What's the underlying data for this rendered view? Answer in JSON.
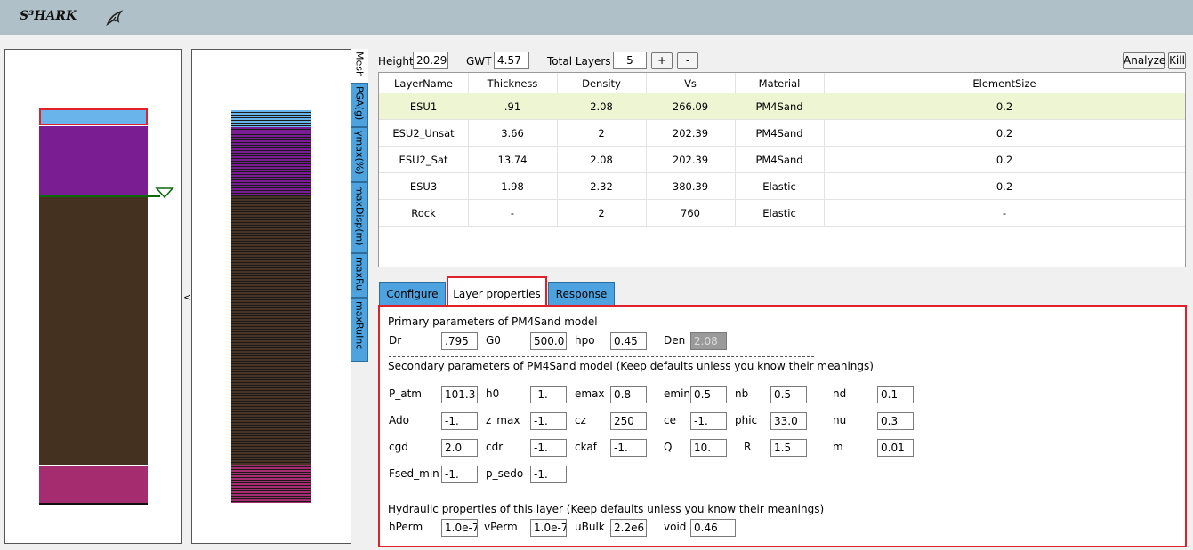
{
  "header": {
    "app_name": "S³HARK",
    "logo_icon": "shark-icon"
  },
  "colors": {
    "top_layer": "#6ab4ec",
    "unsat_layer": "#7a1c92",
    "sat_layer": "#443120",
    "bottom_layer": "#a52d6f",
    "accent_red": "#e0202a",
    "tab_blue": "#4da3e0",
    "selected_row": "#eef5d3",
    "water_table_line": "#0a6a0a"
  },
  "side_tabs": [
    "Mesh",
    "PGA(g)",
    "γmax(%)",
    "maxDisp(m)",
    "maxRu",
    "maxRuInc"
  ],
  "collapse_toggle": "<",
  "toolbar": {
    "height_label": "Height",
    "height_value": "20.29",
    "gwt_label": "GWT",
    "gwt_value": "4.57",
    "total_layers_label": "Total Layers",
    "total_layers_value": "5",
    "plus_label": "+",
    "minus_label": "-",
    "analyze_label": "Analyze",
    "kill_label": "Kill"
  },
  "table": {
    "columns": [
      "LayerName",
      "Thickness",
      "Density",
      "Vs",
      "Material",
      "ElementSize"
    ],
    "rows": [
      [
        "ESU1",
        ".91",
        "2.08",
        "266.09",
        "PM4Sand",
        "0.2"
      ],
      [
        "ESU2_Unsat",
        "3.66",
        "2",
        "202.39",
        "PM4Sand",
        "0.2"
      ],
      [
        "ESU2_Sat",
        "13.74",
        "2.08",
        "202.39",
        "PM4Sand",
        "0.2"
      ],
      [
        "ESU3",
        "1.98",
        "2.32",
        "380.39",
        "Elastic",
        "0.2"
      ],
      [
        "Rock",
        "-",
        "2",
        "760",
        "Elastic",
        "-"
      ]
    ]
  },
  "tabs": [
    "Configure",
    "Layer properties",
    "Response"
  ],
  "layer_props": {
    "primary_title": "Primary parameters of PM4Sand model",
    "primary": [
      [
        "Dr",
        ".795"
      ],
      [
        "G0",
        "500.0"
      ],
      [
        "hpo",
        "0.45"
      ],
      [
        "Den",
        "2.08"
      ]
    ],
    "dashes": "-----------------------------------------------------------------------",
    "secondary_title": "Secondary parameters of PM4Sand model (Keep defaults unless you know their meanings)",
    "secondary": [
      [
        [
          "P_atm",
          "101.3"
        ],
        [
          "h0",
          "-1."
        ],
        [
          "emax",
          "0.8"
        ],
        [
          "emin",
          "0.5"
        ],
        [
          "nb",
          "0.5"
        ],
        [
          "nd",
          "0.1"
        ]
      ],
      [
        [
          "Ado",
          "-1."
        ],
        [
          "z_max",
          "-1."
        ],
        [
          "cz",
          "250"
        ],
        [
          "ce",
          "-1."
        ],
        [
          "phic",
          "33.0"
        ],
        [
          "nu",
          "0.3"
        ]
      ],
      [
        [
          "cgd",
          "2.0"
        ],
        [
          "cdr",
          "-1."
        ],
        [
          "ckaf",
          "-1."
        ],
        [
          "Q",
          "10."
        ],
        [
          "R",
          "1.5"
        ],
        [
          "m",
          "0.01"
        ]
      ],
      [
        [
          "Fsed_min",
          "-1."
        ],
        [
          "p_sedo",
          "-1."
        ]
      ]
    ],
    "hydraulic_title": "Hydraulic properties of this layer (Keep defaults unless you know their meanings)",
    "hydraulic": [
      [
        "hPerm",
        "1.0e-7"
      ],
      [
        "vPerm",
        "1.0e-7"
      ],
      [
        "uBulk",
        "2.2e6"
      ],
      [
        "void",
        "0.46"
      ]
    ]
  }
}
